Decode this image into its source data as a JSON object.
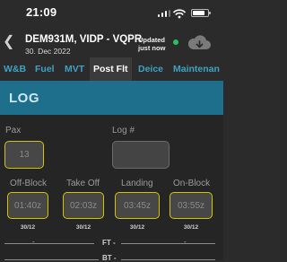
{
  "status_bar": {
    "time": "21:09"
  },
  "header": {
    "flight_title": "DEM931M, VIDP - VQPR",
    "date": "30. Dec 2022",
    "updated_line1": "Updated",
    "updated_line2": "just now"
  },
  "tabs": [
    {
      "label": "W&B",
      "active": false
    },
    {
      "label": "Fuel",
      "active": false
    },
    {
      "label": "MVT",
      "active": false
    },
    {
      "label": "Post Flt",
      "active": true
    },
    {
      "label": "Deice",
      "active": false
    },
    {
      "label": "Maintenan",
      "active": false
    }
  ],
  "section": {
    "title": "LOG"
  },
  "fields": {
    "pax": {
      "label": "Pax",
      "value": "13"
    },
    "log": {
      "label": "Log #",
      "value": ""
    }
  },
  "times": [
    {
      "label": "Off-Block",
      "value": "01:40z",
      "date": "30/12"
    },
    {
      "label": "Take Off",
      "value": "02:03z",
      "date": "30/12"
    },
    {
      "label": "Landing",
      "value": "03:45z",
      "date": "30/12"
    },
    {
      "label": "On-Block",
      "value": "03:55z",
      "date": "30/12"
    }
  ],
  "summary": {
    "ft_label": "FT -",
    "bt_label": "BT -",
    "dash": "-"
  },
  "colors": {
    "background": "#2b2b2b",
    "accent": "#3fa2c1",
    "section_bar": "#1e6f8c",
    "highlight_border": "#d4c400",
    "sync_ok": "#22c55e"
  }
}
